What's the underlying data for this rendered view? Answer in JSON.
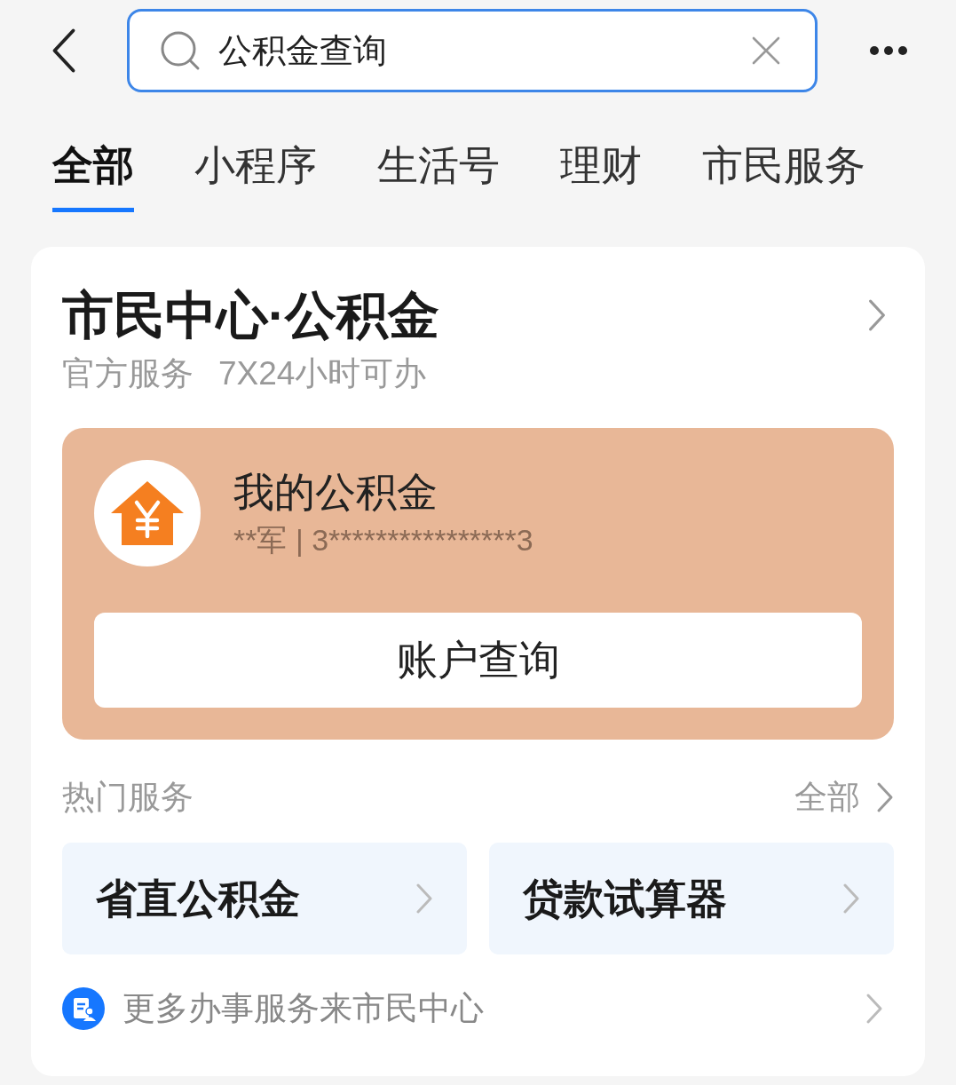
{
  "search": {
    "value": "公积金查询"
  },
  "tabs": [
    {
      "label": "全部",
      "selected": true
    },
    {
      "label": "小程序",
      "selected": false
    },
    {
      "label": "生活号",
      "selected": false
    },
    {
      "label": "理财",
      "selected": false
    },
    {
      "label": "市民服务",
      "selected": false
    }
  ],
  "card": {
    "title": "市民中心·公积金",
    "tags": [
      "官方服务",
      "7X24小时可办"
    ],
    "account": {
      "title": "我的公积金",
      "details": "**军 | 3****************3",
      "button": "账户查询"
    },
    "hot_services": {
      "title": "热门服务",
      "more": "全部",
      "items": [
        "省直公积金",
        "贷款试算器"
      ]
    },
    "footer": "更多办事服务来市民中心"
  }
}
